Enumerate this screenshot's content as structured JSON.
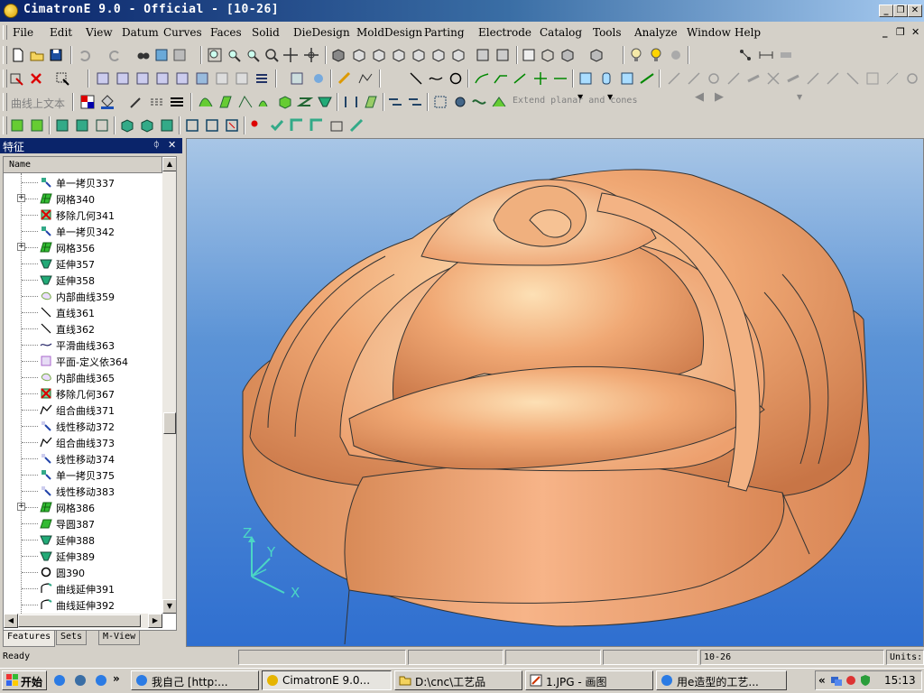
{
  "window": {
    "title": "CimatronE 9.0 - Official - [10-26]"
  },
  "menu": {
    "items": [
      {
        "label": "File"
      },
      {
        "label": "Edit"
      },
      {
        "label": "View"
      },
      {
        "label": "Datum"
      },
      {
        "label": "Curves"
      },
      {
        "label": "Faces"
      },
      {
        "label": "Solid"
      },
      {
        "label": "DieDesign"
      },
      {
        "label": "MoldDesign"
      },
      {
        "label": "Parting"
      },
      {
        "label": "Electrode"
      },
      {
        "label": "Catalog"
      },
      {
        "label": "Tools"
      },
      {
        "label": "Analyze"
      },
      {
        "label": "Window"
      },
      {
        "label": "Help"
      }
    ]
  },
  "toolbar3": {
    "text_on_curve_label": "曲线上文本",
    "extend_label": "Extend planar and cones"
  },
  "panel": {
    "title": "特征",
    "pin_glyph": "ᛰ",
    "close_glyph": "✕",
    "column_header": "Name",
    "items": [
      {
        "label": "单一拷贝337",
        "icon": "copy-icon",
        "expandable": false
      },
      {
        "label": "网格340",
        "icon": "mesh-icon",
        "expandable": true
      },
      {
        "label": "移除几何341",
        "icon": "remove-geometry-icon",
        "expandable": false
      },
      {
        "label": "单一拷贝342",
        "icon": "copy-icon",
        "expandable": false
      },
      {
        "label": "网格356",
        "icon": "mesh-icon",
        "expandable": true
      },
      {
        "label": "延伸357",
        "icon": "extend-icon",
        "expandable": false
      },
      {
        "label": "延伸358",
        "icon": "extend-icon",
        "expandable": false
      },
      {
        "label": "内部曲线359",
        "icon": "inner-curve-icon",
        "expandable": false
      },
      {
        "label": "直线361",
        "icon": "line-icon",
        "expandable": false
      },
      {
        "label": "直线362",
        "icon": "line-icon",
        "expandable": false
      },
      {
        "label": "平滑曲线363",
        "icon": "smooth-curve-icon",
        "expandable": false
      },
      {
        "label": "平面-定义依364",
        "icon": "plane-icon",
        "expandable": false
      },
      {
        "label": "内部曲线365",
        "icon": "inner-curve-icon",
        "expandable": false
      },
      {
        "label": "移除几何367",
        "icon": "remove-geometry-icon",
        "expandable": false
      },
      {
        "label": "组合曲线371",
        "icon": "composite-curve-icon",
        "expandable": false
      },
      {
        "label": "线性移动372",
        "icon": "linear-move-icon",
        "expandable": false
      },
      {
        "label": "组合曲线373",
        "icon": "composite-curve-icon",
        "expandable": false
      },
      {
        "label": "线性移动374",
        "icon": "linear-move-icon",
        "expandable": false
      },
      {
        "label": "单一拷贝375",
        "icon": "copy-icon",
        "expandable": false
      },
      {
        "label": "线性移动383",
        "icon": "linear-move-icon",
        "expandable": false
      },
      {
        "label": "网格386",
        "icon": "mesh-icon",
        "expandable": true
      },
      {
        "label": "导圆387",
        "icon": "fillet-icon",
        "expandable": false
      },
      {
        "label": "延伸388",
        "icon": "extend-icon",
        "expandable": false
      },
      {
        "label": "延伸389",
        "icon": "extend-icon",
        "expandable": false
      },
      {
        "label": "圆390",
        "icon": "circle-icon",
        "expandable": false
      },
      {
        "label": "曲线延伸391",
        "icon": "curve-extend-icon",
        "expandable": false
      },
      {
        "label": "曲线延伸392",
        "icon": "curve-extend-icon",
        "expandable": false
      }
    ],
    "tabs": [
      {
        "label": "Features"
      },
      {
        "label": "Sets"
      },
      {
        "label": "M-View"
      }
    ]
  },
  "viewport": {
    "axis_x": "X",
    "axis_y": "Y",
    "axis_z": "Z"
  },
  "status": {
    "ready": "Ready",
    "doc": "10-26",
    "units": "Units:"
  },
  "taskbar": {
    "start": "开始",
    "tasks": [
      {
        "label": "我自己 [http:..."
      },
      {
        "label": "CimatronE 9.0..."
      },
      {
        "label": "D:\\cnc\\工艺品"
      },
      {
        "label": "1.JPG - 画图"
      },
      {
        "label": "用e造型的工艺..."
      }
    ],
    "quicklaunch_more": "»",
    "tray_more": "«",
    "clock": "15:13"
  },
  "colors": {
    "title_start": "#0a246a",
    "title_end": "#a6caf0",
    "model": "#e9a36e",
    "viewport_top": "#a8c6e6",
    "viewport_bottom": "#2f6fd0"
  }
}
